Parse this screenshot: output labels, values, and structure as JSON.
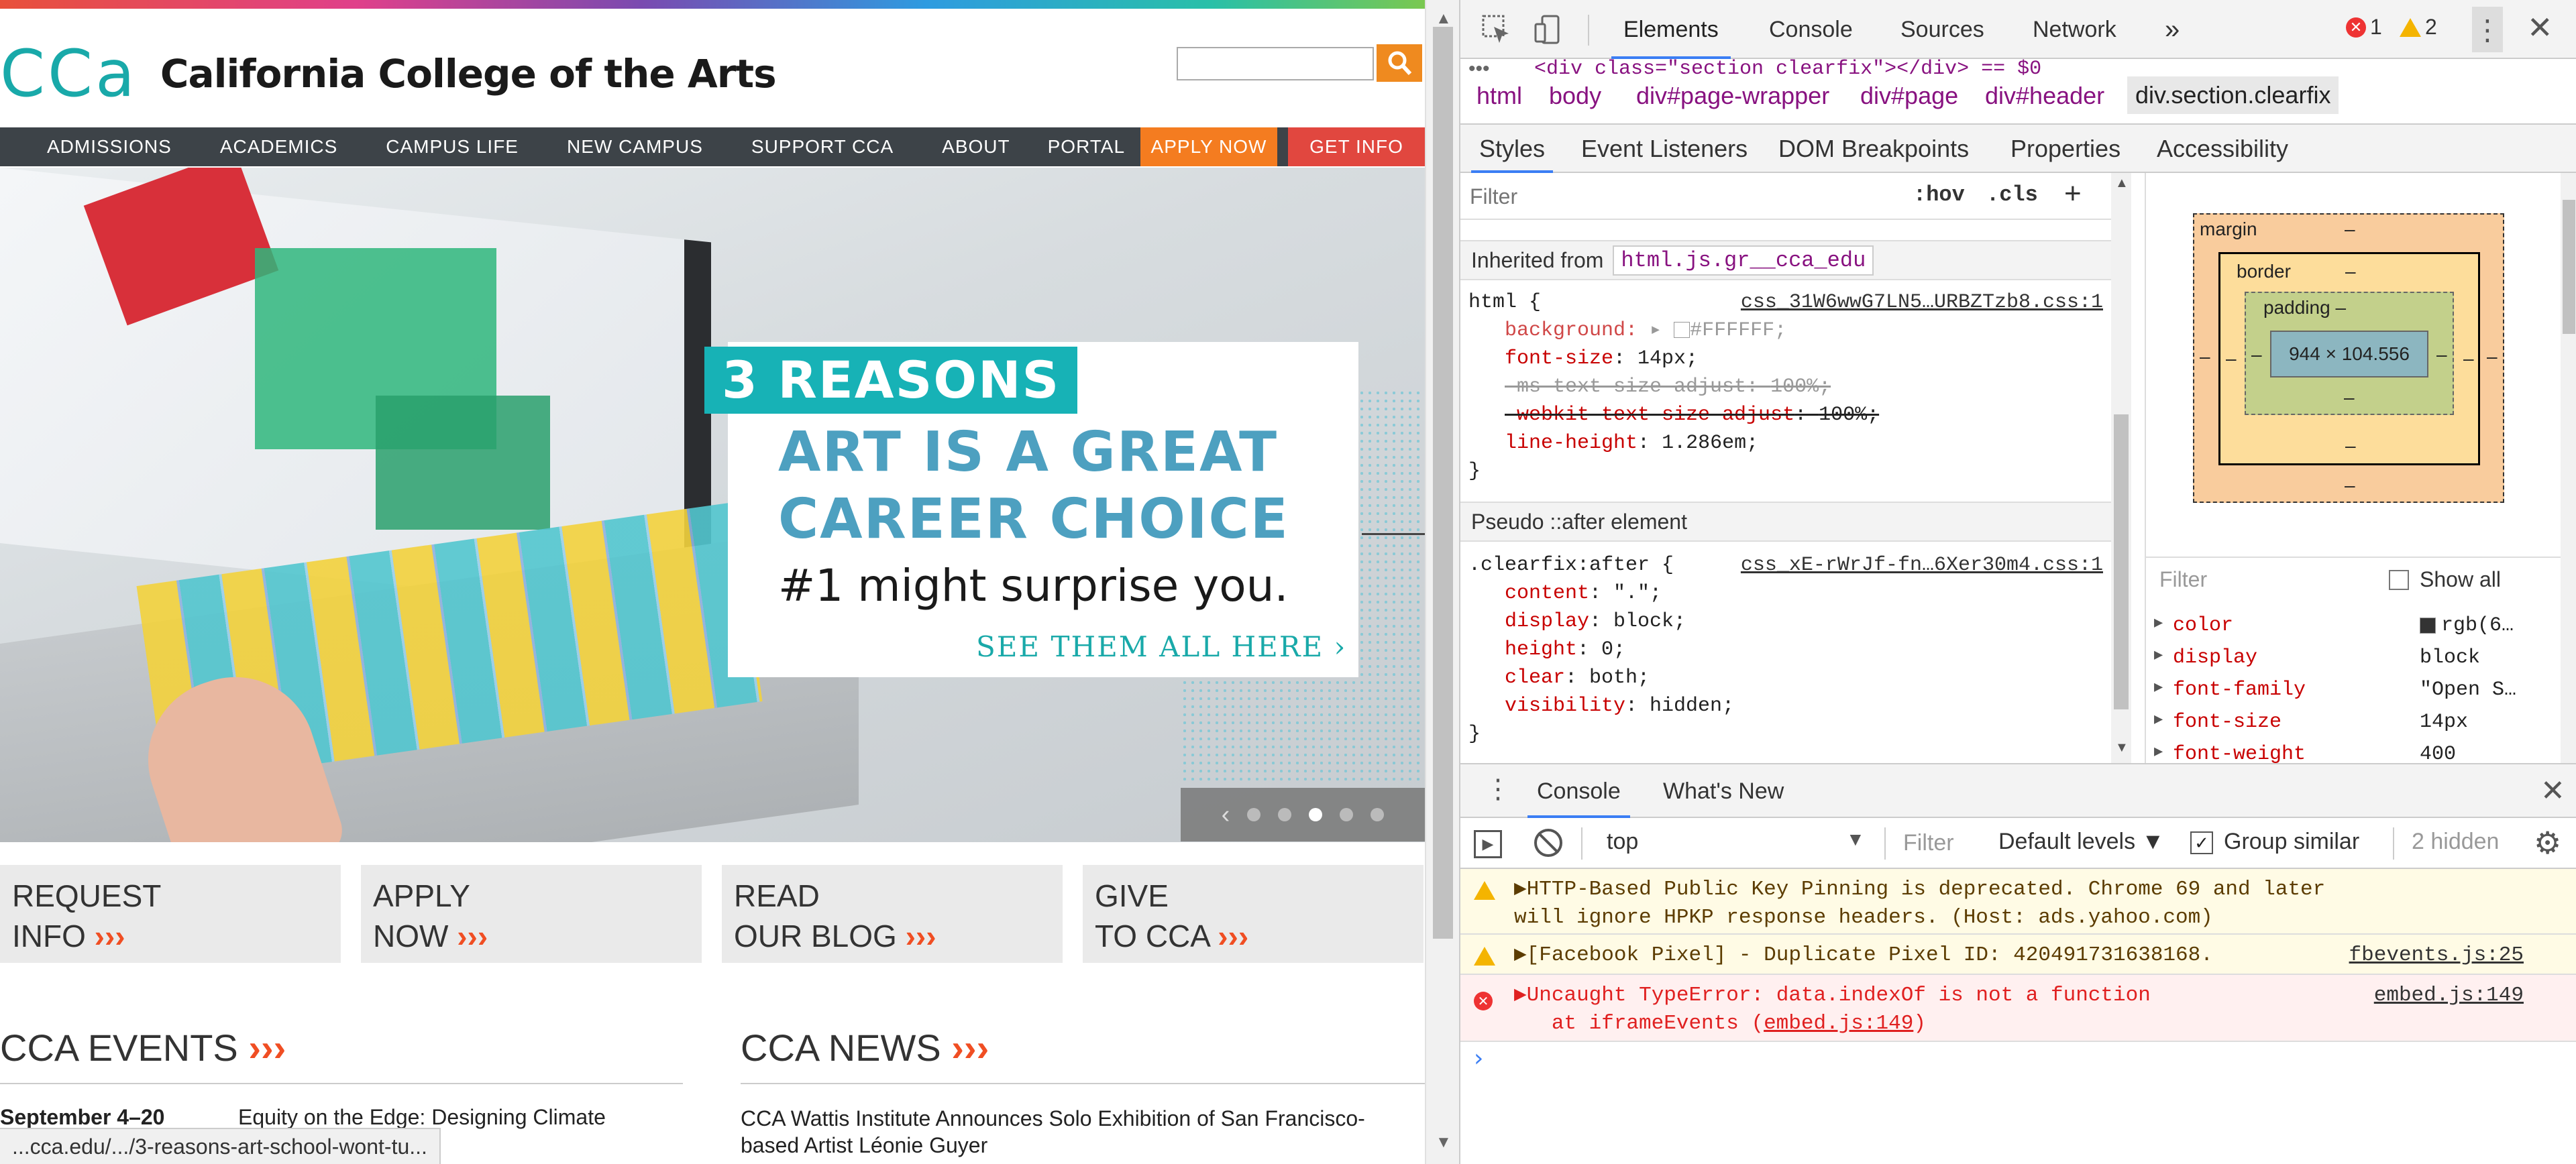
{
  "page": {
    "logo_mark": "CCa",
    "site_name": "California College of the Arts",
    "search_value": "",
    "nav": [
      "ADMISSIONS",
      "ACADEMICS",
      "CAMPUS LIFE",
      "NEW CAMPUS",
      "SUPPORT CCA",
      "ABOUT",
      "PORTAL"
    ],
    "nav_apply": "APPLY NOW",
    "nav_getinfo": "GET INFO",
    "hero": {
      "tag": "3 REASONS",
      "headline_1": "ART IS A GREAT",
      "headline_2": "CAREER CHOICE",
      "subline": "#1 might surprise you.",
      "cta": "SEE THEM ALL HERE",
      "cta_arrow": "›",
      "carousel_prev": "‹",
      "carousel_active_index": 3,
      "carousel_count": 5
    },
    "cards": [
      {
        "line1": "REQUEST",
        "line2": "INFO"
      },
      {
        "line1": "APPLY",
        "line2": "NOW"
      },
      {
        "line1": "READ",
        "line2": "OUR BLOG"
      },
      {
        "line1": "GIVE",
        "line2": "TO CCA"
      }
    ],
    "card_arrows": "›››",
    "events_title": "CCA EVENTS",
    "news_title": "CCA NEWS",
    "section_arrows": "›››",
    "event_date": "September 4–20",
    "event_title": "Equity on the Edge: Designing Climate",
    "news_text": "CCA Wattis Institute Announces Solo Exhibition of San Francisco-based Artist Léonie Guyer",
    "status_url": "...cca.edu/.../3-reasons-art-school-wont-tu..."
  },
  "devtools": {
    "tabs": [
      "Elements",
      "Console",
      "Sources",
      "Network"
    ],
    "more_tabs": "»",
    "error_count": "1",
    "warning_count": "2",
    "partial_node": "<div class=\"section clearfix\"></div> == $0",
    "breadcrumbs": [
      "html",
      "body",
      "div#page-wrapper",
      "div#page",
      "div#header",
      "div.section.clearfix"
    ],
    "subtabs": [
      "Styles",
      "Event Listeners",
      "DOM Breakpoints",
      "Properties",
      "Accessibility"
    ],
    "styles_filter_placeholder": "Filter",
    "hov": ":hov",
    "cls": ".cls",
    "inherited_label": "Inherited from",
    "inherited_selector": "html.js.gr__cca_edu",
    "rule1_selector": "html {",
    "rule1_source": "css_31W6wwG7LN5…URBZTzb8.css:1",
    "rule1_props": [
      {
        "name": "background",
        "value": "#FFFFFF;"
      },
      {
        "name": "font-size",
        "value": "14px;"
      },
      {
        "name": "-ms-text-size-adjust",
        "value": "100%;"
      },
      {
        "name": "-webkit-text-size-adjust",
        "value": "100%;"
      },
      {
        "name": "line-height",
        "value": "1.286em;"
      }
    ],
    "close_brace": "}",
    "pseudo_label": "Pseudo ::after element",
    "rule2_selector": ".clearfix:after {",
    "rule2_source": "css_xE-rWrJf-fn…6Xer30m4.css:1",
    "rule2_props": [
      {
        "name": "content",
        "value": "\".\";"
      },
      {
        "name": "display",
        "value": "block;"
      },
      {
        "name": "height",
        "value": "0;"
      },
      {
        "name": "clear",
        "value": "both;"
      },
      {
        "name": "visibility",
        "value": "hidden;"
      }
    ],
    "boxmodel": {
      "margin_label": "margin",
      "border_label": "border",
      "padding_label": "padding",
      "dash": "–",
      "content_size": "944 × 104.556"
    },
    "computed_filter_placeholder": "Filter",
    "show_all": "Show all",
    "computed": [
      {
        "name": "color",
        "value": "rgb(6…"
      },
      {
        "name": "display",
        "value": "block"
      },
      {
        "name": "font-family",
        "value": "\"Open S…"
      },
      {
        "name": "font-size",
        "value": "14px"
      },
      {
        "name": "font-weight",
        "value": "400"
      }
    ],
    "drawer_tabs": [
      "Console",
      "What's New"
    ],
    "context": "top",
    "console_filter_placeholder": "Filter",
    "levels": "Default levels ▼",
    "group_similar": "Group similar",
    "hidden_count": "2 hidden",
    "messages": [
      {
        "type": "warn",
        "text": "▶HTTP-Based Public Key Pinning is deprecated. Chrome 69 and later will ignore HPKP response headers. (Host: ads.yahoo.com)",
        "source": ""
      },
      {
        "type": "warn",
        "text": "▶[Facebook Pixel] - Duplicate Pixel ID: 420491731638168.",
        "source": "fbevents.js:25"
      },
      {
        "type": "err",
        "text": "▶Uncaught TypeError: data.indexOf is not a function",
        "text2_prefix": "at iframeEvents (",
        "text2_link": "embed.js:149",
        "text2_suffix": ")",
        "source": "embed.js:149"
      }
    ],
    "prompt": "›"
  }
}
